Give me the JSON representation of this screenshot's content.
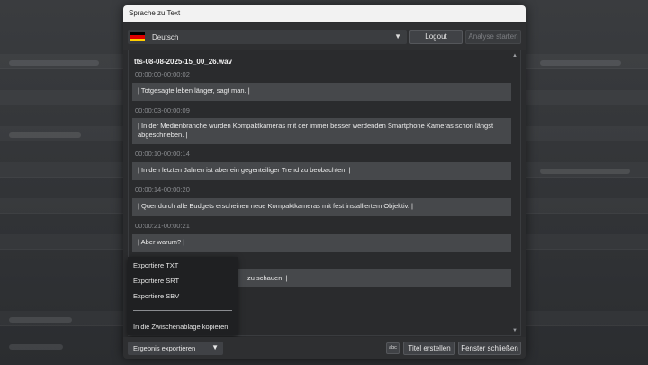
{
  "dialog": {
    "title": "Sprache zu Text"
  },
  "toolbar": {
    "language": "Deutsch",
    "logout_label": "Logout",
    "analyze_label": "Analyse starten"
  },
  "colors": {
    "flag": [
      "#000000",
      "#dd0000",
      "#ffce00"
    ]
  },
  "transcript": {
    "filename": "tts-08-08-2025-15_00_26.wav",
    "segments": [
      {
        "time": "00:00:00-00:00:02",
        "text": "| Totgesagte leben länger, sagt man. |"
      },
      {
        "time": "00:00:03-00:00:09",
        "text": "| In der Medienbranche wurden Kompaktkameras mit der immer besser werdenden Smartphone Kameras schon längst abgeschrieben. |"
      },
      {
        "time": "00:00:10-00:00:14",
        "text": "| In den letzten Jahren ist aber ein gegenteiliger Trend zu beobachten. |"
      },
      {
        "time": "00:00:14-00:00:20",
        "text": "| Quer durch alle Budgets erscheinen neue Kompaktkameras mit fest installiertem Objektiv. |"
      },
      {
        "time": "00:00:21-00:00:21",
        "text": "| Aber warum? |"
      },
      {
        "time": "",
        "text": "zu schauen. |"
      }
    ]
  },
  "export_menu": {
    "items": [
      "Exportiere TXT",
      "Exportiere SRT",
      "Exportiere SBV",
      "In die Zwischenablage kopieren"
    ]
  },
  "bottom": {
    "export_label": "Ergebnis exportieren",
    "spellcheck_icon": "abc",
    "create_title_label": "Titel erstellen",
    "close_label": "Fenster schließen"
  },
  "icons": {
    "language_caret": "▼",
    "export_caret": "▼",
    "scroll_up": "▲",
    "scroll_down": "▼"
  }
}
